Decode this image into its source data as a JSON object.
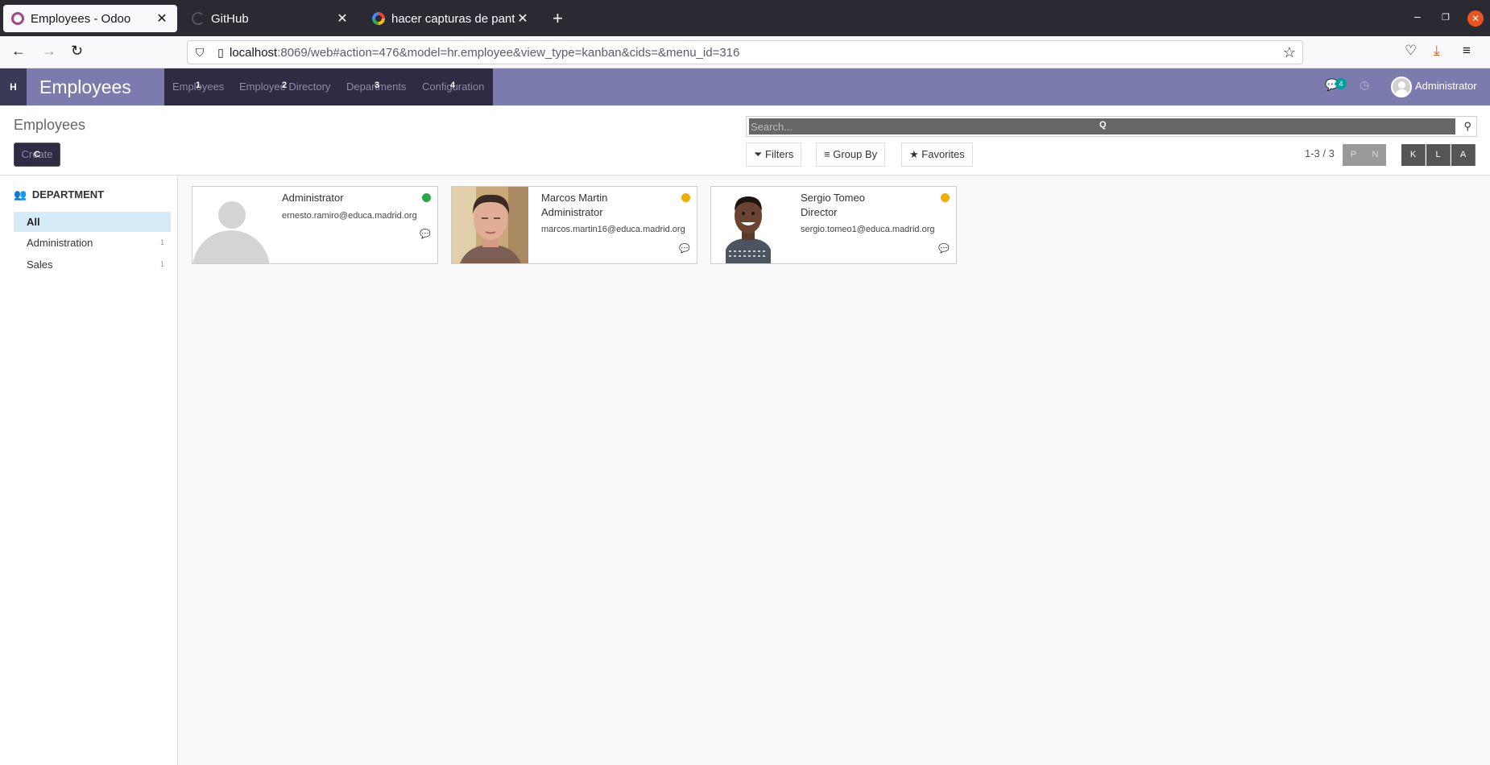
{
  "browser": {
    "tabs": [
      {
        "title": "Employees - Odoo",
        "icon": "odoo-icon",
        "active": true
      },
      {
        "title": "GitHub",
        "icon": "github-icon",
        "active": false
      },
      {
        "title": "hacer capturas de pantall",
        "icon": "google-icon",
        "active": false
      }
    ],
    "url_host": "localhost",
    "url_rest": ":8069/web#action=476&model=hr.employee&view_type=kanban&cids=&menu_id=316"
  },
  "odoo_nav": {
    "apps_hotkey": "H",
    "brand": "Employees",
    "menu": [
      {
        "label": "Employees",
        "hotkey": "1"
      },
      {
        "label": "Employee Directory",
        "hotkey": "2"
      },
      {
        "label": "Departments",
        "hotkey": "3"
      },
      {
        "label": "Configuration",
        "hotkey": "4"
      }
    ],
    "messages_count": "4",
    "user": "Administrator"
  },
  "control_panel": {
    "title": "Employees",
    "create_label": "Create",
    "create_hotkey": "C",
    "search_placeholder": "Search...",
    "search_hotkey": "Q",
    "filters_label": "Filters",
    "groupby_label": "Group By",
    "favorites_label": "Favorites",
    "pager": "1-3 / 3",
    "pager_prev_hotkey": "P",
    "pager_next_hotkey": "N",
    "view_hotkeys": [
      "K",
      "L",
      "A"
    ]
  },
  "search_panel": {
    "header": "DEPARTMENT",
    "items": [
      {
        "label": "All",
        "count": "",
        "active": true
      },
      {
        "label": "Administration",
        "count": "1",
        "active": false
      },
      {
        "label": "Sales",
        "count": "1",
        "active": false
      }
    ]
  },
  "employees": [
    {
      "name": "Administrator",
      "job": "",
      "email": "ernesto.ramiro@educa.madrid.org",
      "status_color": "#28a745",
      "image": "placeholder"
    },
    {
      "name": "Marcos Martin",
      "job": "Administrator",
      "email": "marcos.martin16@educa.madrid.org",
      "status_color": "#f0ad00",
      "image": "photo"
    },
    {
      "name": "Sergio Tomeo",
      "job": "Director",
      "email": "sergio.tomeo1@educa.madrid.org",
      "status_color": "#f0ad00",
      "image": "photo"
    }
  ]
}
